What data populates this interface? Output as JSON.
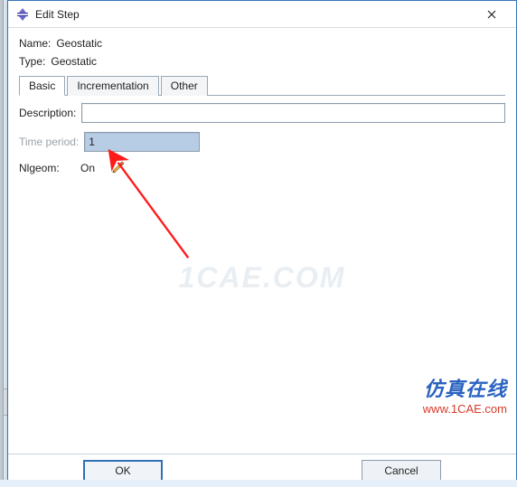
{
  "window": {
    "title": "Edit Step"
  },
  "info": {
    "name_label": "Name:",
    "name_value": "Geostatic",
    "type_label": "Type:",
    "type_value": "Geostatic"
  },
  "tabs": {
    "basic": "Basic",
    "incrementation": "Incrementation",
    "other": "Other"
  },
  "basic_panel": {
    "description_label": "Description:",
    "description_value": "",
    "time_label": "Time period:",
    "time_value": "1",
    "nlgeom_label": "Nlgeom:",
    "nlgeom_value": "On"
  },
  "buttons": {
    "ok": "OK",
    "cancel": "Cancel"
  },
  "watermark": "1CAE.COM",
  "brand": {
    "cn": "仿真在线",
    "url": "www.1CAE.com"
  }
}
